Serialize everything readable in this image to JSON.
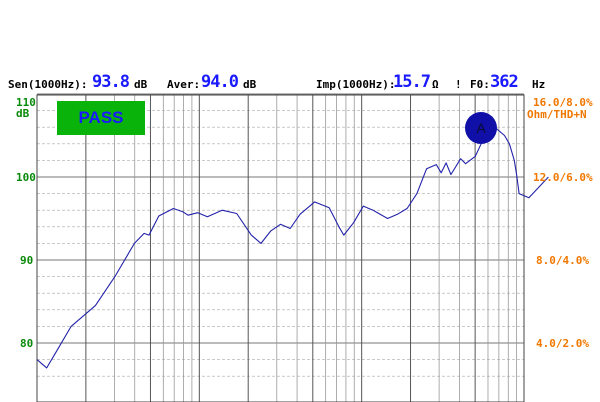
{
  "readout": {
    "sen_label": "Sen(1000Hz):",
    "sen_value": "93.8",
    "sen_unit": "dB",
    "aver_label": "Aver:",
    "aver_value": "94.0",
    "aver_unit": "dB",
    "imp_label": "Imp(1000Hz):",
    "imp_value": "15.7",
    "imp_unit": "Ω",
    "sep": "!",
    "f0_label": "F0:",
    "f0_value": "362",
    "f0_unit": "Hz"
  },
  "badge": {
    "label": "PASS"
  },
  "marker": {
    "label": "A"
  },
  "colors": {
    "curve": "#2222aa",
    "pass": "#0ab30a",
    "left_axis": "#0a8a0a",
    "right_axis": "#f07800",
    "marker": "#1010a8"
  },
  "chart_data": {
    "type": "line",
    "left_axis": {
      "unit_label": "dB",
      "ticks": [
        "110",
        "100",
        "90",
        "80"
      ],
      "range": [
        76,
        110
      ]
    },
    "right_axis": {
      "labels": [
        "16.0/8.0%",
        "Ohm/THD+N",
        "12.0/6.0%",
        "8.0/4.0%",
        "4.0/2.0%"
      ],
      "ticks": [
        "16.0/8.0%",
        "12.0/6.0%",
        "8.0/4.0%",
        "4.0/2.0%"
      ]
    },
    "x_scale": "log",
    "grid": true,
    "series": [
      {
        "values": [
          [
            0,
            78
          ],
          [
            0.02,
            77
          ],
          [
            0.04,
            79
          ],
          [
            0.07,
            82
          ],
          [
            0.12,
            84.5
          ],
          [
            0.16,
            88
          ],
          [
            0.2,
            92
          ],
          [
            0.22,
            93.2
          ],
          [
            0.23,
            93
          ],
          [
            0.25,
            95.3
          ],
          [
            0.28,
            96.2
          ],
          [
            0.3,
            95.8
          ],
          [
            0.31,
            95.4
          ],
          [
            0.33,
            95.7
          ],
          [
            0.35,
            95.2
          ],
          [
            0.38,
            96
          ],
          [
            0.41,
            95.6
          ],
          [
            0.44,
            93
          ],
          [
            0.46,
            92
          ],
          [
            0.48,
            93.5
          ],
          [
            0.5,
            94.3
          ],
          [
            0.52,
            93.8
          ],
          [
            0.54,
            95.5
          ],
          [
            0.57,
            97
          ],
          [
            0.6,
            96.3
          ],
          [
            0.62,
            94
          ],
          [
            0.63,
            93
          ],
          [
            0.65,
            94.5
          ],
          [
            0.67,
            96.5
          ],
          [
            0.69,
            96
          ],
          [
            0.72,
            95
          ],
          [
            0.74,
            95.5
          ],
          [
            0.76,
            96.2
          ],
          [
            0.78,
            98
          ],
          [
            0.8,
            101
          ],
          [
            0.82,
            101.5
          ],
          [
            0.83,
            100.5
          ],
          [
            0.84,
            101.7
          ],
          [
            0.85,
            100.3
          ],
          [
            0.87,
            102.2
          ],
          [
            0.88,
            101.6
          ],
          [
            0.9,
            102.5
          ],
          [
            0.92,
            105
          ],
          [
            0.94,
            106
          ],
          [
            0.96,
            105
          ],
          [
            0.97,
            104
          ],
          [
            0.98,
            102
          ],
          [
            0.985,
            100.2
          ],
          [
            0.99,
            98
          ],
          [
            1.01,
            97.5
          ],
          [
            1.05,
            100
          ]
        ]
      }
    ]
  }
}
